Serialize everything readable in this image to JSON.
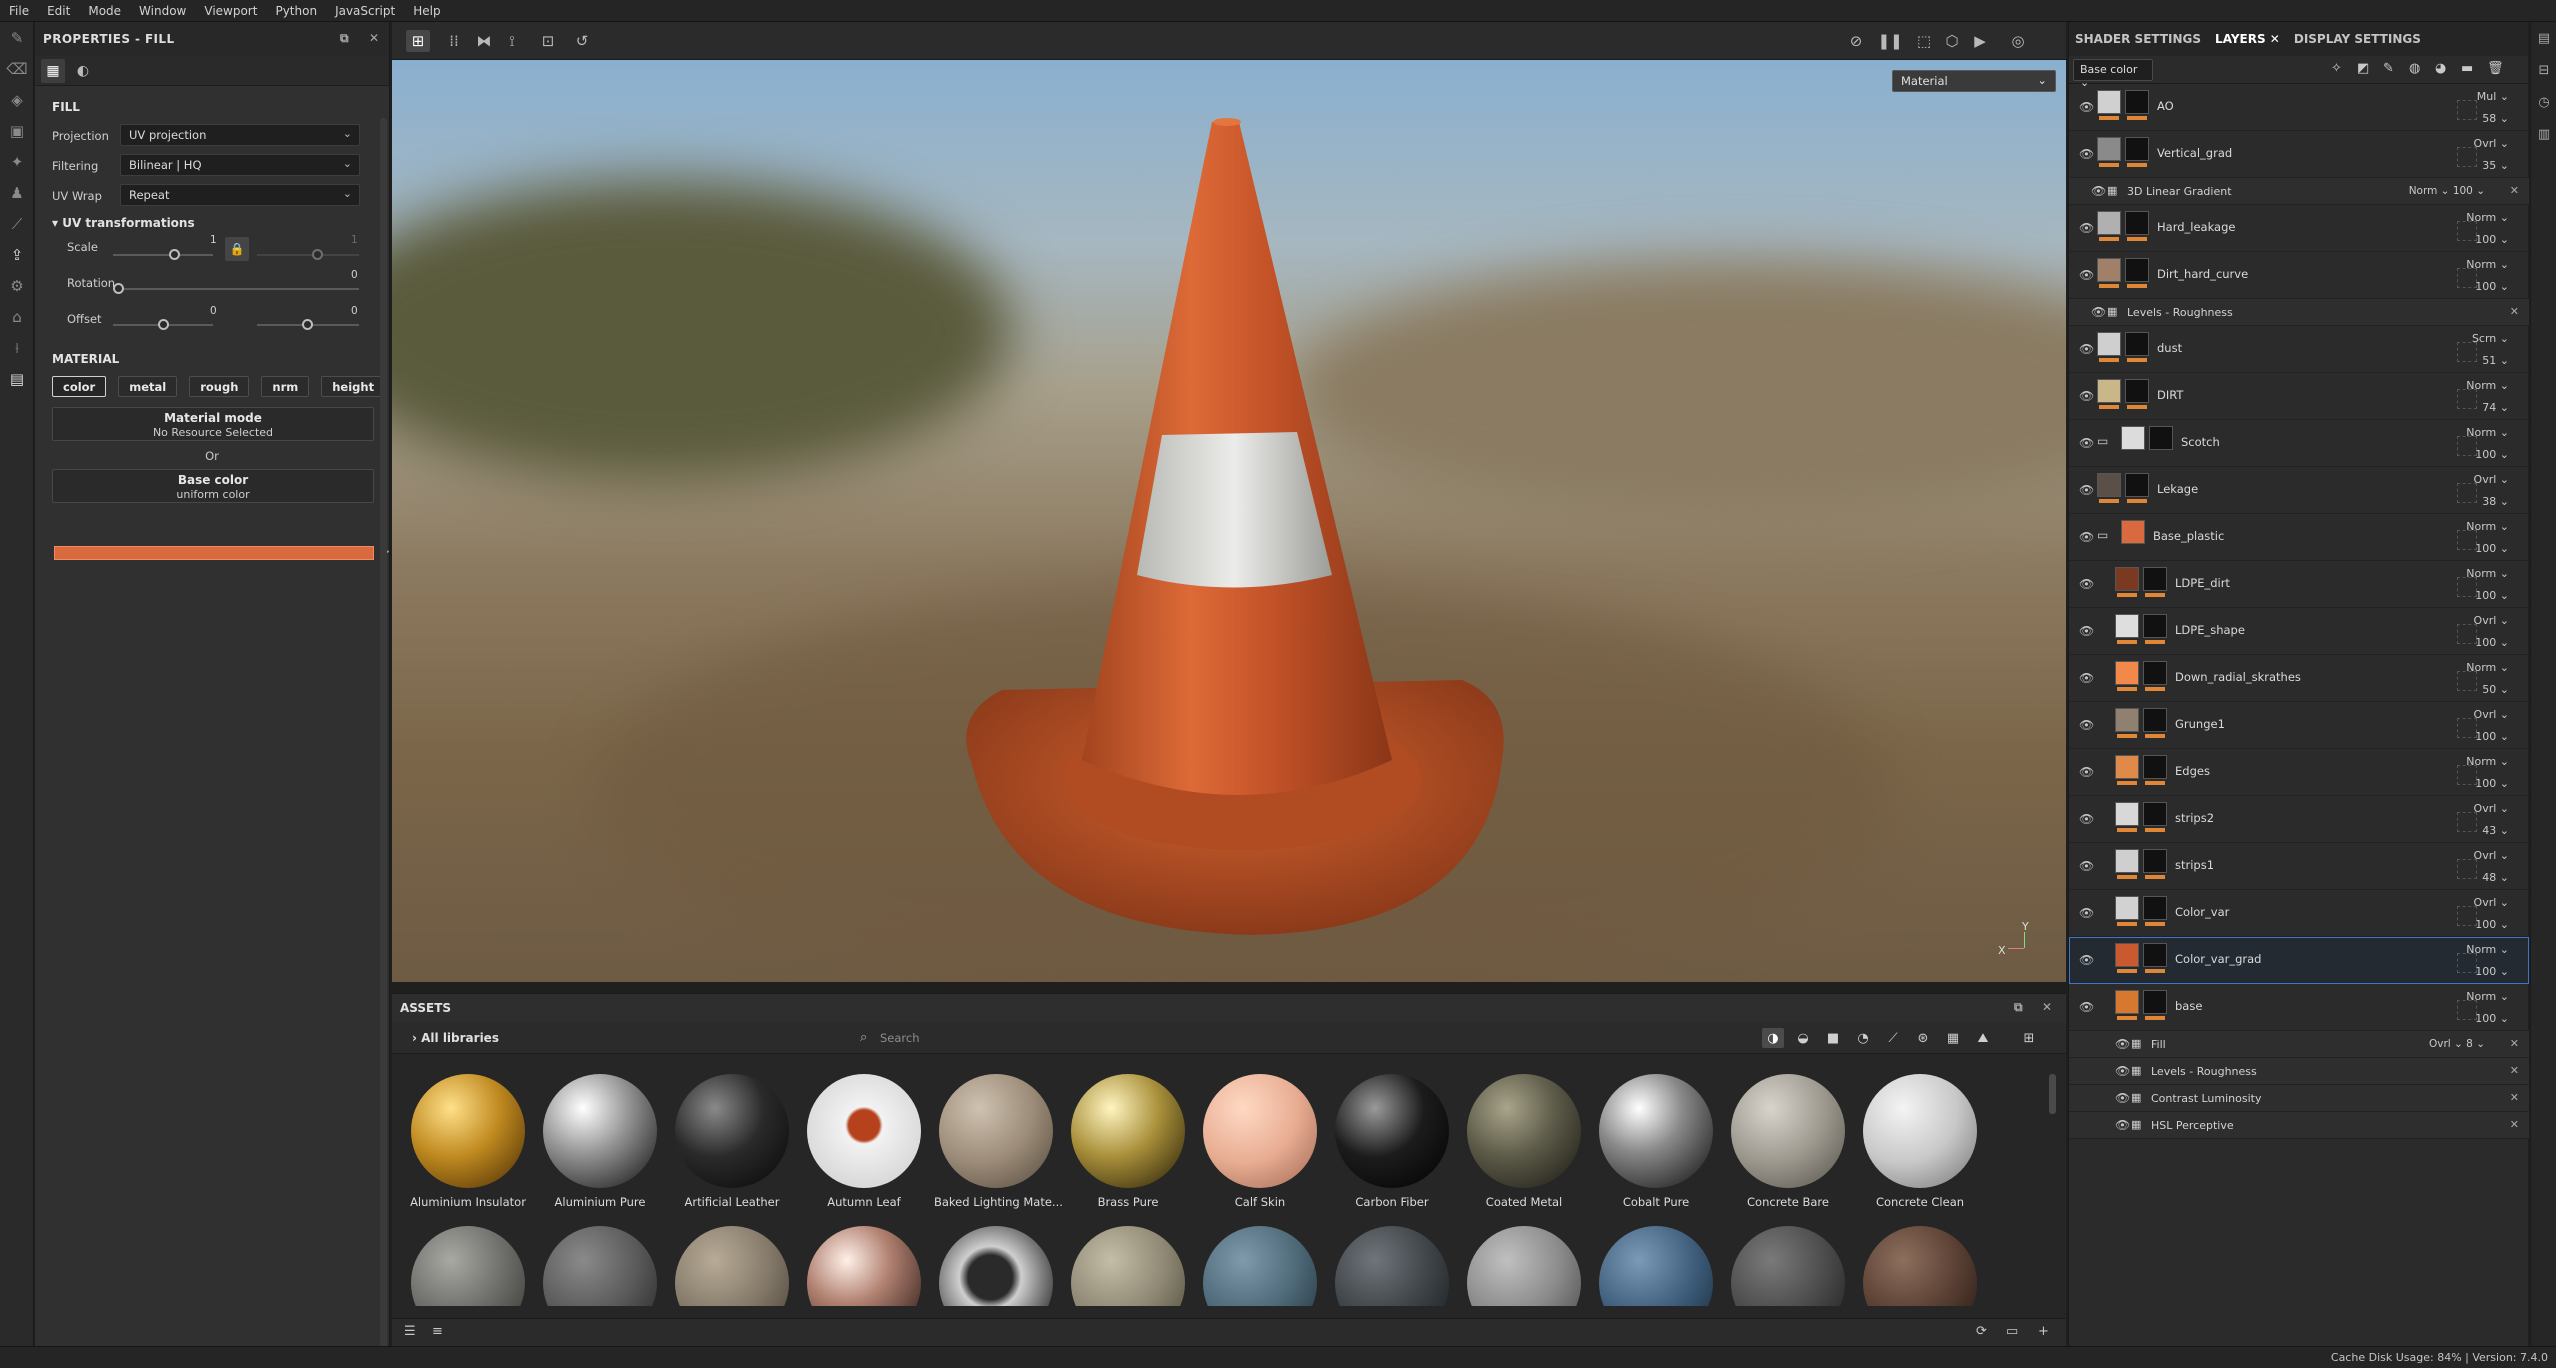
{
  "menu": [
    "File",
    "Edit",
    "Mode",
    "Window",
    "Viewport",
    "Python",
    "JavaScript",
    "Help"
  ],
  "properties": {
    "title": "PROPERTIES - FILL",
    "fill_section": "FILL",
    "projection": {
      "label": "Projection",
      "value": "UV projection"
    },
    "filtering": {
      "label": "Filtering",
      "value": "Bilinear | HQ"
    },
    "uv_wrap": {
      "label": "UV Wrap",
      "value": "Repeat"
    },
    "uv_transforms": "UV transformations",
    "scale": {
      "label": "Scale",
      "value1": "1",
      "value2": "1"
    },
    "rotation": {
      "label": "Rotation",
      "value": "0"
    },
    "offset": {
      "label": "Offset",
      "value1": "0",
      "value2": "0"
    },
    "material_section": "MATERIAL",
    "channels": [
      "color",
      "metal",
      "rough",
      "nrm",
      "height"
    ],
    "material_mode_title": "Material mode",
    "material_mode_sub": "No Resource Selected",
    "or": "Or",
    "base_color_title": "Base color",
    "base_color_sub": "uniform color",
    "base_color_hex": "#d96a3f"
  },
  "viewport": {
    "material_select": "Material",
    "axis_y": "Y",
    "axis_x": "X"
  },
  "assets": {
    "title": "ASSETS",
    "library": "All libraries",
    "search_placeholder": "Search",
    "items": [
      {
        "name": "Aluminium Insulator"
      },
      {
        "name": "Aluminium Pure"
      },
      {
        "name": "Artificial Leather"
      },
      {
        "name": "Autumn Leaf"
      },
      {
        "name": "Baked Lighting Mate..."
      },
      {
        "name": "Brass Pure"
      },
      {
        "name": "Calf Skin"
      },
      {
        "name": "Carbon Fiber"
      },
      {
        "name": "Coated Metal"
      },
      {
        "name": "Cobalt Pure"
      },
      {
        "name": "Concrete Bare"
      },
      {
        "name": "Concrete Clean"
      }
    ]
  },
  "right_panel": {
    "tabs": [
      "SHADER SETTINGS",
      "LAYERS",
      "DISPLAY SETTINGS"
    ],
    "channel_select": "Base color",
    "layers": [
      {
        "name": "AO",
        "blend": "Mul",
        "opacity": "58"
      },
      {
        "name": "Vertical_grad",
        "blend": "Ovrl",
        "opacity": "35"
      },
      {
        "name": "3D Linear Gradient",
        "blend": "Norm",
        "opacity": "100",
        "sub": true
      },
      {
        "name": "Hard_leakage",
        "blend": "Norm",
        "opacity": "100"
      },
      {
        "name": "Dirt_hard_curve",
        "blend": "Norm",
        "opacity": "100"
      },
      {
        "name": "Levels - Roughness",
        "sub": true
      },
      {
        "name": "dust",
        "blend": "Scrn",
        "opacity": "51"
      },
      {
        "name": "DIRT",
        "blend": "Norm",
        "opacity": "74"
      },
      {
        "name": "Scotch",
        "blend": "Norm",
        "opacity": "100"
      },
      {
        "name": "Lekage",
        "blend": "Ovrl",
        "opacity": "38"
      },
      {
        "name": "Base_plastic",
        "blend": "Norm",
        "opacity": "100"
      },
      {
        "name": "LDPE_dirt",
        "blend": "Norm",
        "opacity": "100"
      },
      {
        "name": "LDPE_shape",
        "blend": "Ovrl",
        "opacity": "100"
      },
      {
        "name": "Down_radial_skrathes",
        "blend": "Norm",
        "opacity": "50"
      },
      {
        "name": "Grunge1",
        "blend": "Ovrl",
        "opacity": "100"
      },
      {
        "name": "Edges",
        "blend": "Norm",
        "opacity": "100"
      },
      {
        "name": "strips2",
        "blend": "Ovrl",
        "opacity": "43"
      },
      {
        "name": "strips1",
        "blend": "Ovrl",
        "opacity": "48"
      },
      {
        "name": "Color_var",
        "blend": "Ovrl",
        "opacity": "100"
      },
      {
        "name": "Color_var_grad",
        "blend": "Norm",
        "opacity": "100"
      },
      {
        "name": "base",
        "blend": "Norm",
        "opacity": "100"
      },
      {
        "name": "Fill",
        "blend": "Ovrl",
        "opacity": "8",
        "sub": true
      },
      {
        "name": "Levels - Roughness",
        "sub": true
      },
      {
        "name": "Contrast Luminosity",
        "sub": true
      },
      {
        "name": "HSL Perceptive",
        "sub": true
      }
    ]
  },
  "status": {
    "text": "Cache Disk Usage:  84% | Version: 7.4.0"
  }
}
